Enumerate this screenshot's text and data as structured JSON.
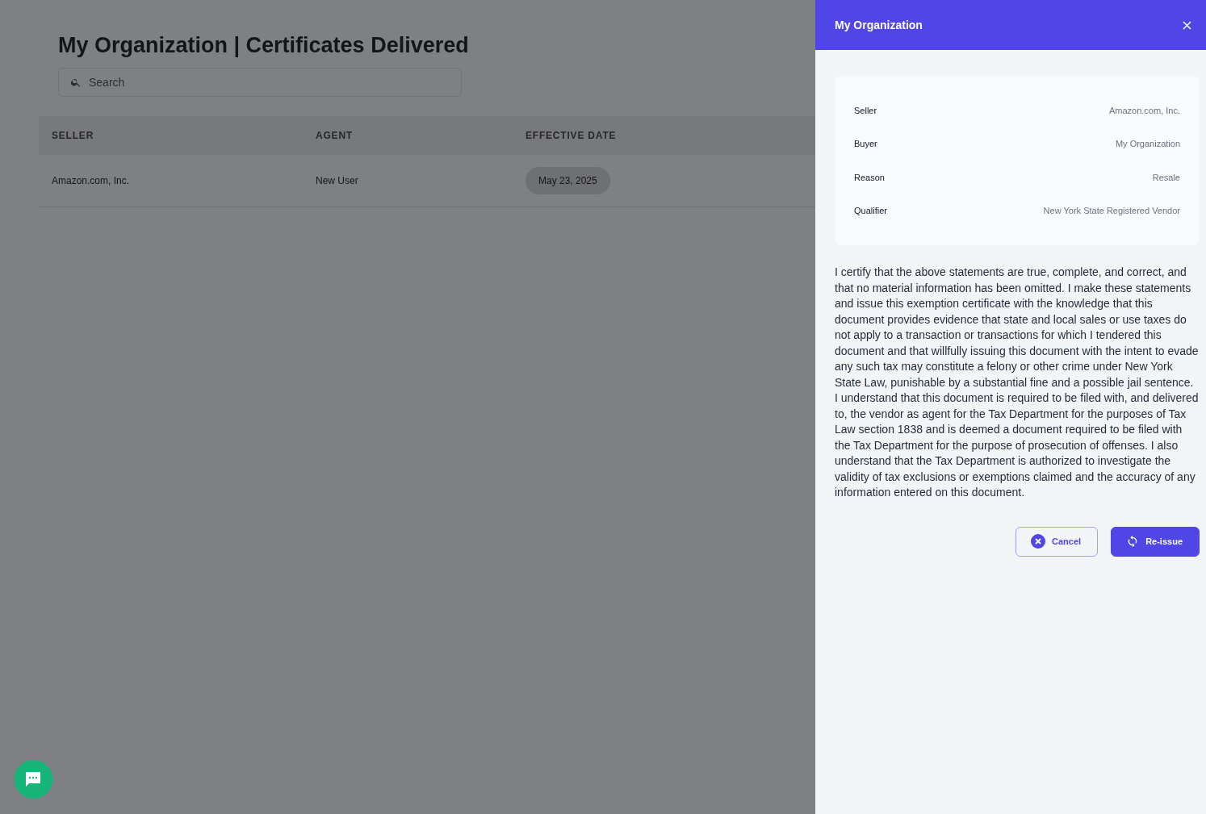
{
  "page": {
    "title": "My Organization | Certificates Delivered",
    "search": {
      "placeholder": "Search"
    }
  },
  "table": {
    "columns": [
      "SELLER",
      "AGENT",
      "EFFECTIVE DATE"
    ],
    "rows": [
      {
        "seller": "Amazon.com, Inc.",
        "agent": "New User",
        "effective_date": "May 23, 2025"
      }
    ]
  },
  "drawer": {
    "title": "My Organization",
    "details": [
      {
        "label": "Seller",
        "value": "Amazon.com, Inc."
      },
      {
        "label": "Buyer",
        "value": "My Organization"
      },
      {
        "label": "Reason",
        "value": "Resale"
      },
      {
        "label": "Qualifier",
        "value": "New York State Registered Vendor"
      }
    ],
    "statement": "I certify that the above statements are true, complete, and correct, and that no material information has been omitted. I make these statements and issue this exemption certificate with the knowledge that this document provides evidence that state and local sales or use taxes do not apply to a transaction or transactions for which I tendered this document and that willfully issuing this document with the intent to evade any such tax may constitute a felony or other crime under New York State Law, punishable by a substantial fine and a possible jail sentence. I understand that this document is required to be filed with, and delivered to, the vendor as agent for the Tax Department for the purposes of Tax Law section 1838 and is deemed a document required to be filed with the Tax Department for the purpose of prosecution of offenses. I also understand that the Tax Department is authorized to investigate the validity of tax exclusions or exemptions claimed and the accuracy of any information entered on this document.",
    "buttons": [
      {
        "kind": "cancel",
        "label": "Cancel"
      },
      {
        "kind": "reissue",
        "label": "Re-issue"
      }
    ]
  }
}
